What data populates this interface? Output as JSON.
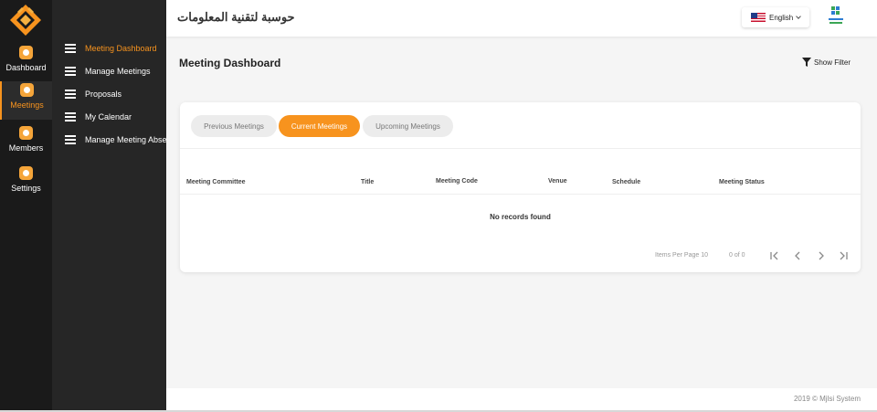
{
  "rail": {
    "items": [
      {
        "label": "Dashboard"
      },
      {
        "label": "Meetings"
      },
      {
        "label": "Members"
      },
      {
        "label": "Settings"
      }
    ]
  },
  "submenu": {
    "items": [
      {
        "label": "Meeting Dashboard"
      },
      {
        "label": "Manage Meetings"
      },
      {
        "label": "Proposals"
      },
      {
        "label": "My Calendar"
      },
      {
        "label": "Manage Meeting Absence"
      }
    ]
  },
  "header": {
    "company_name": "حوسبة لتقنية المعلومات",
    "language": "English"
  },
  "main": {
    "page_title": "Meeting Dashboard",
    "filter_label": "Show Filter",
    "tabs": [
      {
        "label": "Previous Meetings"
      },
      {
        "label": "Current Meetings"
      },
      {
        "label": "Upcoming Meetings"
      }
    ],
    "table": {
      "columns": [
        "Meeting Committee",
        "Title",
        "Meeting Code",
        "Venue",
        "Schedule",
        "Meeting Status"
      ],
      "empty_message": "No records found"
    },
    "pagination": {
      "items_per_page_label": "Items Per Page 10",
      "range": "0 of 0"
    }
  },
  "footer": {
    "copyright": "2019 © Mjlsi System"
  },
  "colors": {
    "accent": "#f7931e",
    "rail_bg": "#1a1a1a",
    "submenu_bg": "#262626"
  }
}
